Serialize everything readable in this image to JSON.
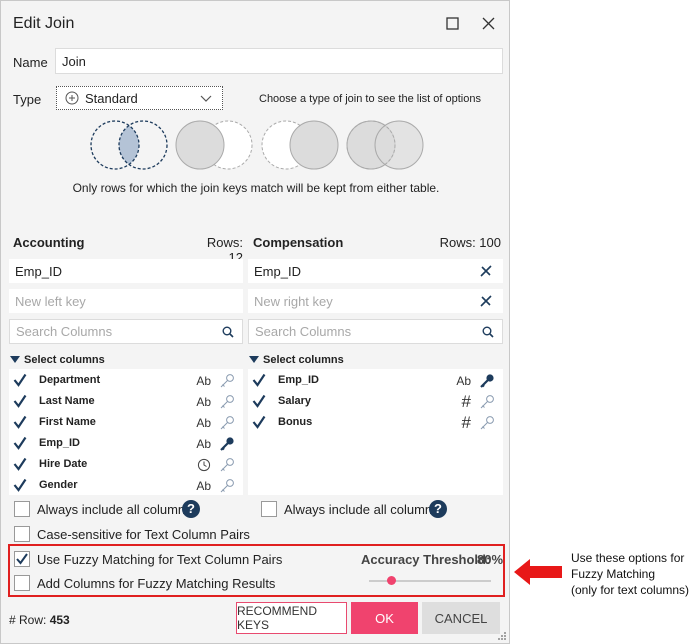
{
  "dialog": {
    "title": "Edit Join"
  },
  "name": {
    "label": "Name",
    "value": "Join"
  },
  "type": {
    "label": "Type",
    "selected": "Standard",
    "hint": "Choose a type of join to see the list of options",
    "description": "Only rows for which the join keys match will be kept from either table."
  },
  "left": {
    "table": "Accounting",
    "rows": "Rows: 12",
    "key": "Emp_ID",
    "new_key_placeholder": "New left key",
    "search_placeholder": "Search Columns",
    "select_label": "Select columns",
    "columns": [
      {
        "name": "Department",
        "type": "Ab",
        "key": false
      },
      {
        "name": "Last Name",
        "type": "Ab",
        "key": false
      },
      {
        "name": "First Name",
        "type": "Ab",
        "key": false
      },
      {
        "name": "Emp_ID",
        "type": "Ab",
        "key": true
      },
      {
        "name": "Hire Date",
        "type": "clock",
        "key": false
      },
      {
        "name": "Gender",
        "type": "Ab",
        "key": false
      }
    ],
    "always_include": "Always include all columns"
  },
  "right": {
    "table": "Compensation",
    "rows": "Rows: 100",
    "key": "Emp_ID",
    "new_key_placeholder": "New right key",
    "search_placeholder": "Search Columns",
    "select_label": "Select columns",
    "columns": [
      {
        "name": "Emp_ID",
        "type": "Ab",
        "key": true
      },
      {
        "name": "Salary",
        "type": "#",
        "key": false
      },
      {
        "name": "Bonus",
        "type": "#",
        "key": false
      }
    ],
    "always_include": "Always include all columns"
  },
  "options": {
    "case_sensitive": "Case-sensitive for Text Column Pairs",
    "fuzzy": "Use Fuzzy Matching for Text Column Pairs",
    "fuzzy_checked": true,
    "add_columns": "Add Columns for Fuzzy Matching Results",
    "threshold_label": "Accuracy Threshold:",
    "threshold_value": "80%",
    "threshold_fraction": 0.18
  },
  "footer": {
    "row_label": "# Row:",
    "row_count": "453",
    "recommend": "RECOMMEND KEYS",
    "ok": "OK",
    "cancel": "CANCEL"
  },
  "annotation": {
    "line1": "Use these options for",
    "line2": "Fuzzy Matching",
    "line3": "(only for text columns)"
  },
  "colors": {
    "accent": "#f0436e",
    "check": "#1d3b5c",
    "highlight": "#e02020"
  }
}
